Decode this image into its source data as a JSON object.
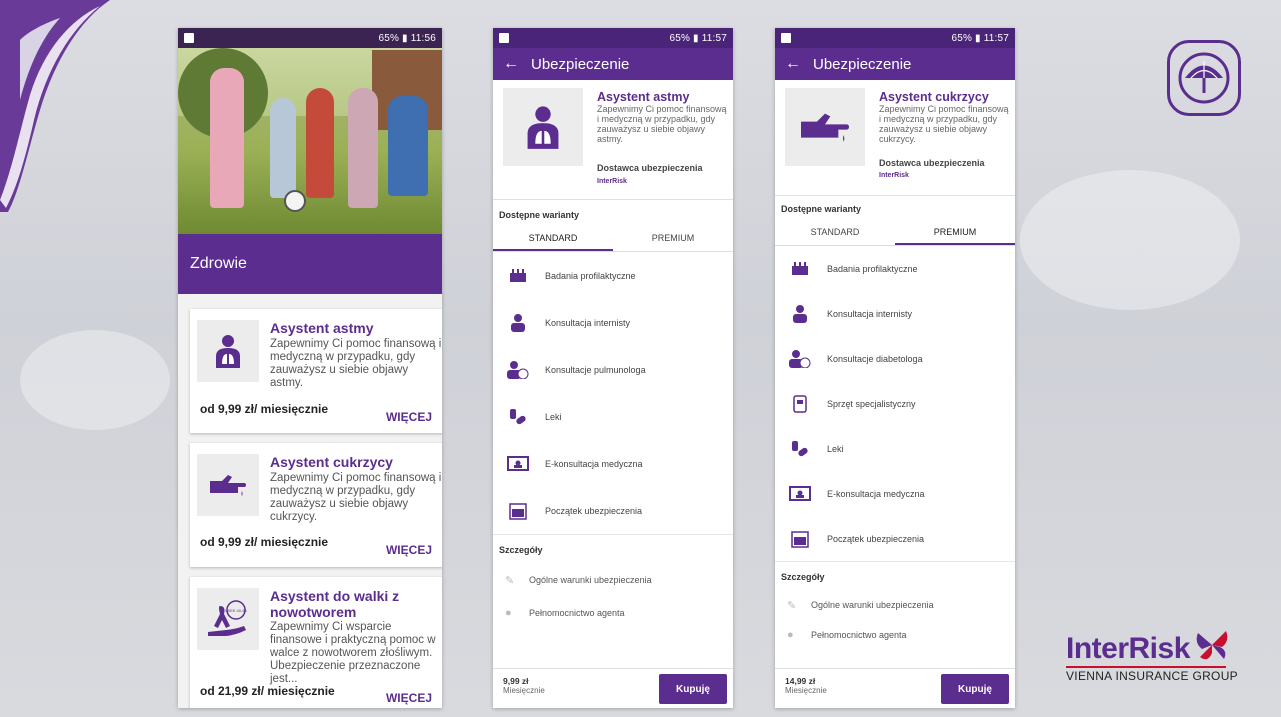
{
  "status_bar": {
    "phone1": "65% ▮ 11:56",
    "phone2": "65% ▮ 11:57",
    "phone3": "65% ▮ 11:57"
  },
  "phone1": {
    "section_title": "Zdrowie",
    "cards": [
      {
        "title": "Asystent astmy",
        "description": "Zapewnimy Ci pomoc finansową i medyczną w przypadku, gdy zauważysz u siebie objawy astmy.",
        "price": "od 9,99 zł/ miesięcznie",
        "more": "WIĘCEJ",
        "icon": "doctor-lungs-icon"
      },
      {
        "title": "Asystent cukrzycy",
        "description": "Zapewnimy Ci pomoc finansową i medyczną w przypadku, gdy zauważysz u siebie objawy cukrzycy.",
        "price": "od 9,99 zł/ miesięcznie",
        "more": "WIĘCEJ",
        "icon": "finger-drop-icon"
      },
      {
        "title": "Asystent do walki z nowotworem",
        "description": "Zapewnimy Ci wsparcie finansowe i praktyczną pomoc w walce z nowotworem złośliwym. Ubezpieczenie przeznaczone jest...",
        "price": "od 21,99 zł/ miesięcznie",
        "more": "WIĘCEJ",
        "icon": "ribbon-hand-icon",
        "badge": "WIEK 40-64"
      }
    ]
  },
  "phone2": {
    "appbar_title": "Ubezpieczenie",
    "product_title": "Asystent astmy",
    "product_desc": "Zapewnimy Ci pomoc finansową i medyczną w przypadku, gdy zauważysz u siebie objawy astmy.",
    "provider_label": "Dostawca ubezpieczenia",
    "provider_logo": "InterRisk",
    "variants_label": "Dostępne warianty",
    "tab_standard": "STANDARD",
    "tab_premium": "PREMIUM",
    "features": [
      "Badania profilaktyczne",
      "Konsultacja internisty",
      "Konsultacje pulmunologa",
      "Leki",
      "E-konsultacja medyczna",
      "Początek ubezpieczenia"
    ],
    "details_label": "Szczegóły",
    "details": [
      "Ogólne warunki ubezpieczenia",
      "Pełnomocnictwo agenta"
    ],
    "price": "9,99 zł",
    "period": "Miesięcznie",
    "buy": "Kupuję"
  },
  "phone3": {
    "appbar_title": "Ubezpieczenie",
    "product_title": "Asystent cukrzycy",
    "product_desc": "Zapewnimy Ci pomoc finansową i medyczną w przypadku, gdy zauważysz u siebie objawy cukrzycy.",
    "provider_label": "Dostawca ubezpieczenia",
    "provider_logo": "InterRisk",
    "variants_label": "Dostępne warianty",
    "tab_standard": "STANDARD",
    "tab_premium": "PREMIUM",
    "features": [
      "Badania profilaktyczne",
      "Konsultacja internisty",
      "Konsultacje diabetologa",
      "Sprzęt specjalistyczny",
      "Leki",
      "E-konsultacja medyczna",
      "Początek ubezpieczenia"
    ],
    "details_label": "Szczegóły",
    "details": [
      "Ogólne warunki ubezpieczenia",
      "Pełnomocnictwo agenta"
    ],
    "price": "14,99 zł",
    "period": "Miesięcznie",
    "buy": "Kupuję"
  },
  "brand": {
    "name": "InterRisk",
    "tagline": "VIENNA INSURANCE GROUP"
  },
  "colors": {
    "primary": "#5b2d8e",
    "accent_red": "#c8102e"
  }
}
